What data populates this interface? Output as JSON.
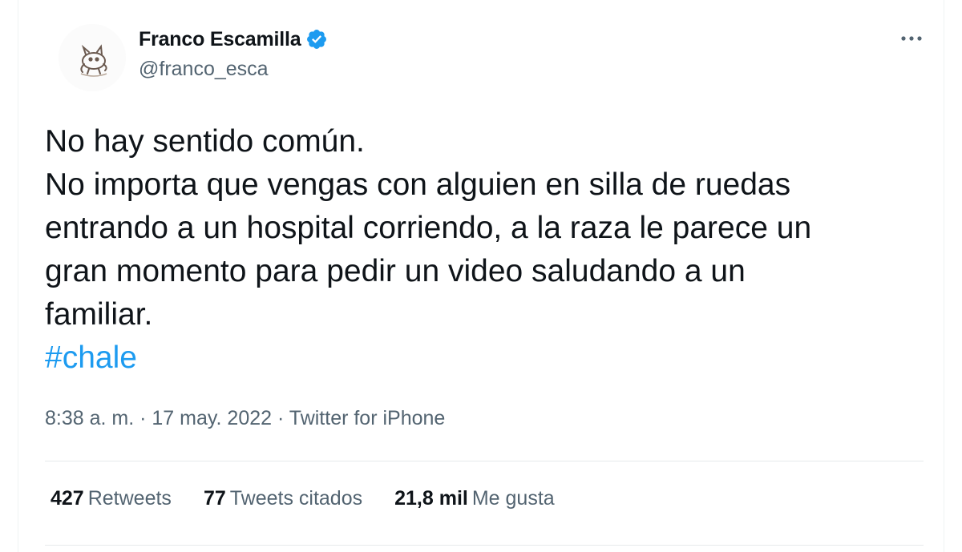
{
  "author": {
    "name": "Franco Escamilla",
    "handle": "@franco_esca",
    "verified": true
  },
  "tweet": {
    "lines": [
      "No hay sentido común.",
      "No importa que vengas con alguien en silla de ruedas",
      "entrando a un hospital corriendo, a la raza le parece un",
      "gran momento para pedir un video saludando a un",
      "familiar."
    ],
    "hashtag": "#chale"
  },
  "meta": {
    "time": "8:38 a. m.",
    "sep1": " · ",
    "date": "17 may. 2022",
    "sep2": " · ",
    "source": "Twitter for iPhone"
  },
  "stats": {
    "retweets_count": "427",
    "retweets_label": "Retweets",
    "quotes_count": "77",
    "quotes_label": "Tweets citados",
    "likes_count": "21,8 mil",
    "likes_label": "Me gusta"
  },
  "colors": {
    "accent": "#1d9bf0",
    "secondary_text": "#536471",
    "primary_text": "#0f1419"
  },
  "icons": {
    "verified": "verified-badge-icon",
    "more": "more-options-icon",
    "avatar": "profile-avatar-cat-illustration"
  }
}
